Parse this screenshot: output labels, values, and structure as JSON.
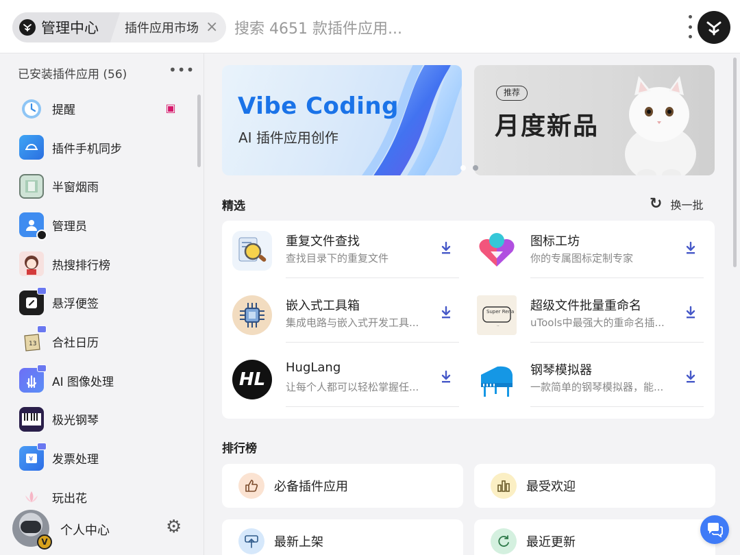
{
  "topbar": {
    "home_label": "管理中心",
    "tab_label": "插件应用市场",
    "search_placeholder": "搜索 4651 款插件应用..."
  },
  "sidebar": {
    "header": "已安装插件应用 (56)",
    "items": [
      {
        "label": "提醒",
        "icon": "alarm-clock-icon"
      },
      {
        "label": "插件手机同步",
        "icon": "sync-icon"
      },
      {
        "label": "半窗烟雨",
        "icon": "window-icon"
      },
      {
        "label": "管理员",
        "icon": "admin-user-icon"
      },
      {
        "label": "热搜排行榜",
        "icon": "anime-girl-icon"
      },
      {
        "label": "悬浮便签",
        "icon": "paperclip-note-icon"
      },
      {
        "label": "合社日历",
        "icon": "calendar-icon"
      },
      {
        "label": "AI 图像处理",
        "icon": "hand-sign-icon"
      },
      {
        "label": "极光钢琴",
        "icon": "piano-keys-icon"
      },
      {
        "label": "发票处理",
        "icon": "invoice-yen-icon"
      },
      {
        "label": "玩出花",
        "icon": "lotus-icon"
      }
    ],
    "footer_label": "个人中心"
  },
  "banners": {
    "vibe_title": "Vibe Coding",
    "vibe_subtitle": "AI 插件应用创作",
    "monthly_tag": "推荐",
    "monthly_title": "月度新品"
  },
  "featured": {
    "title": "精选",
    "refresh_label": "换一批",
    "items": [
      {
        "name": "重复文件查找",
        "desc": "查找目录下的重复文件",
        "icon": "duplicate-file-search-icon"
      },
      {
        "name": "图标工坊",
        "desc": "你的专属图标定制专家",
        "icon": "heart-icon"
      },
      {
        "name": "嵌入式工具箱",
        "desc": "集成电路与嵌入式开发工具...",
        "icon": "chip-icon"
      },
      {
        "name": "超级文件批量重命名",
        "desc": "uTools中最强大的重命名插...",
        "icon": "super-renamer-icon",
        "logo_text": "Super Renamer"
      },
      {
        "name": "HugLang",
        "desc": "让每个人都可以轻松掌握任...",
        "icon": "huglang-icon",
        "logo_text": "HL"
      },
      {
        "name": "钢琴模拟器",
        "desc": "一款简单的钢琴模拟器，能...",
        "icon": "grand-piano-icon"
      }
    ]
  },
  "ranking": {
    "title": "排行榜",
    "items": [
      {
        "label": "必备插件应用",
        "icon": "thumbs-up-icon",
        "color": "#fbe3d2"
      },
      {
        "label": "最受欢迎",
        "icon": "bar-chart-icon",
        "color": "#fbefc4"
      },
      {
        "label": "最新上架",
        "icon": "upload-icon",
        "color": "#d6e8fb"
      },
      {
        "label": "最近更新",
        "icon": "refresh-icon",
        "color": "#d4f0df"
      }
    ]
  },
  "colors": {
    "accent": "#1a73e8",
    "download": "#4658c8",
    "chip_red": "#d6186b"
  }
}
